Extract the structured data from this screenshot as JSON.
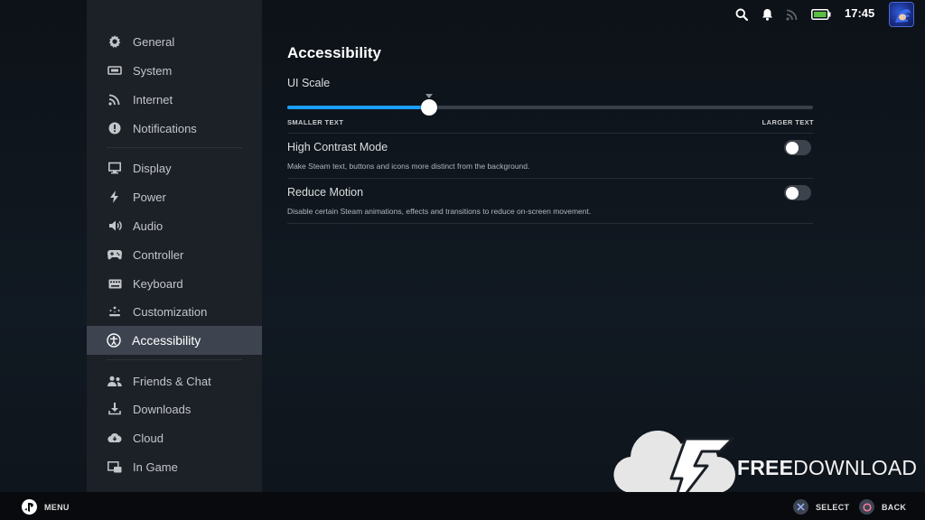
{
  "app": {
    "page_title": "Accessibility"
  },
  "statusbar": {
    "time": "17:45",
    "icons": [
      "search-icon",
      "bell-icon",
      "wifi-icon",
      "battery-icon"
    ]
  },
  "sidebar": {
    "items": [
      {
        "label": "General",
        "icon": "gear-icon"
      },
      {
        "label": "System",
        "icon": "system-icon"
      },
      {
        "label": "Internet",
        "icon": "wifi-icon"
      },
      {
        "label": "Notifications",
        "icon": "alert-icon"
      },
      {
        "label": "Display",
        "icon": "monitor-icon"
      },
      {
        "label": "Power",
        "icon": "lightning-icon"
      },
      {
        "label": "Audio",
        "icon": "speaker-icon"
      },
      {
        "label": "Controller",
        "icon": "gamepad-icon"
      },
      {
        "label": "Keyboard",
        "icon": "keyboard-icon"
      },
      {
        "label": "Customization",
        "icon": "sparkle-icon"
      },
      {
        "label": "Accessibility",
        "icon": "accessibility-icon",
        "active": true
      },
      {
        "label": "Friends & Chat",
        "icon": "friends-icon"
      },
      {
        "label": "Downloads",
        "icon": "download-icon"
      },
      {
        "label": "Cloud",
        "icon": "cloud-icon"
      },
      {
        "label": "In Game",
        "icon": "in-game-icon"
      }
    ]
  },
  "settings": {
    "ui_scale": {
      "label": "UI Scale",
      "value_fraction": 0.27,
      "min_label": "SMALLER TEXT",
      "max_label": "LARGER TEXT"
    },
    "high_contrast": {
      "title": "High Contrast Mode",
      "description": "Make Steam text, buttons and icons more distinct from the background.",
      "enabled": false
    },
    "reduce_motion": {
      "title": "Reduce Motion",
      "description": "Disable certain Steam animations, effects and transitions to reduce on-screen movement.",
      "enabled": false
    }
  },
  "bottombar": {
    "menu_label": "MENU",
    "select_label": "SELECT",
    "back_label": "BACK"
  },
  "watermark": {
    "bold": "FREE",
    "light": "DOWNLOAD"
  },
  "colors": {
    "accent": "#1a9fff",
    "sidebar_bg": "#1c2027",
    "active_bg": "#3d4450"
  }
}
